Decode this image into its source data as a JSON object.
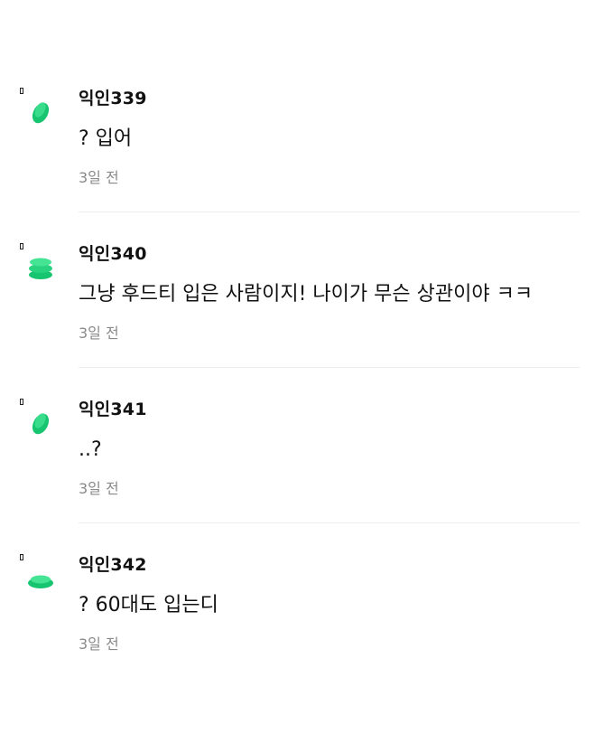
{
  "accent_color": "#22d17c",
  "comments": [
    {
      "nickname": "익인339",
      "text": "? 입어",
      "time": "3일 전",
      "avatar_icon": "leaf-icon"
    },
    {
      "nickname": "익인340",
      "text": "그냥 후드티 입은 사람이지! 나이가 무슨 상관이야 ㅋㅋ",
      "time": "3일 전",
      "avatar_icon": "stack-icon"
    },
    {
      "nickname": "익인341",
      "text": "..?",
      "time": "3일 전",
      "avatar_icon": "leaf-icon"
    },
    {
      "nickname": "익인342",
      "text": "? 60대도 입는디",
      "time": "3일 전",
      "avatar_icon": "disc-icon"
    }
  ]
}
